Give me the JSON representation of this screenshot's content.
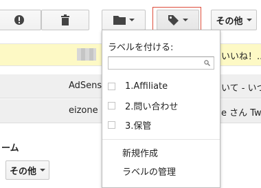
{
  "toolbar": {
    "report_spam_icon": "exclamation-icon",
    "delete_icon": "trash-icon",
    "move_to_icon": "folder-icon",
    "labels_icon": "tag-icon",
    "more_label": "その他"
  },
  "background_rows": {
    "row1_text": "いいね！...",
    "row2_sender": "AdSense",
    "row2_text": "いて - いつ",
    "row3_sender": "eizone",
    "row3_text": "e さん Tw",
    "footer_fragment": "ーム",
    "bottom_more_label": "その他"
  },
  "label_menu": {
    "title": "ラベルを付ける:",
    "search_placeholder": "",
    "labels": [
      {
        "name": "1.Affiliate"
      },
      {
        "name": "2.問い合わせ"
      },
      {
        "name": "3.保管"
      }
    ],
    "create_new": "新規作成",
    "manage": "ラベルの管理"
  },
  "colors": {
    "highlight_border": "#dd4b39",
    "yellow_row": "#fdf9c5"
  }
}
